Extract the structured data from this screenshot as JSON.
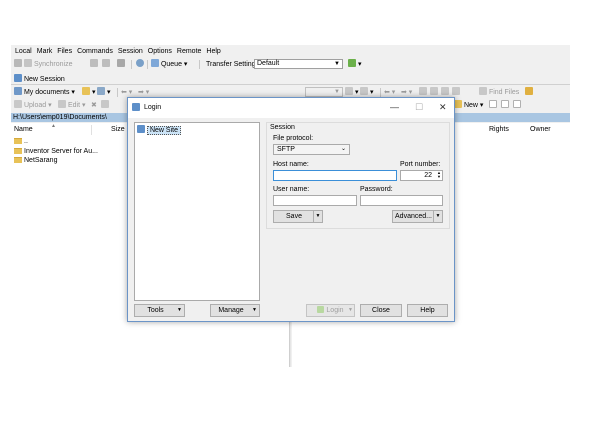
{
  "menu": [
    "Local",
    "Mark",
    "Files",
    "Commands",
    "Session",
    "Options",
    "Remote",
    "Help"
  ],
  "toolbar1": {
    "synchronize": "Synchronize",
    "queue": "Queue",
    "transfer_settings_label": "Transfer Settings",
    "transfer_settings_value": "Default"
  },
  "tab": {
    "new_session": "New Session"
  },
  "toolbar2": {
    "my_documents": "My documents",
    "find_files": "Find Files",
    "new": "New"
  },
  "toolbar3": {
    "upload": "Upload",
    "edit": "Edit"
  },
  "local": {
    "path": "H:\\Users\\emp019\\Documents\\",
    "columns": {
      "name": "Name",
      "size": "Size"
    },
    "rows": [
      "..",
      "Inventor Server for Au...",
      "NetSarang"
    ]
  },
  "remote": {
    "columns": {
      "rights": "Rights",
      "owner": "Owner"
    }
  },
  "dialog": {
    "title": "Login",
    "minimize": "—",
    "maximize": "☐",
    "close": "✕",
    "sites": [
      "New Site"
    ],
    "session_group": "Session",
    "file_protocol_label": "File protocol:",
    "file_protocol_value": "SFTP",
    "host_name_label": "Host name:",
    "host_name_value": "",
    "port_label": "Port number:",
    "port_value": "22",
    "user_name_label": "User name:",
    "user_name_value": "",
    "password_label": "Password:",
    "password_value": "",
    "save": "Save",
    "advanced": "Advanced...",
    "tools": "Tools",
    "manage": "Manage",
    "login": "Login",
    "close_btn": "Close",
    "help": "Help"
  }
}
